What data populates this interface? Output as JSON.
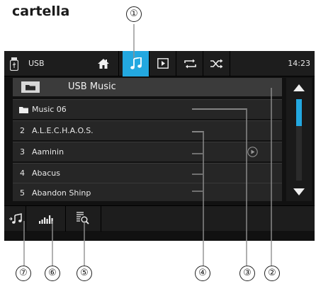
{
  "caption": "cartella",
  "topbar": {
    "source_label": "USB",
    "time": "14:23",
    "active_tab_color": "#23a8e0",
    "icons": [
      "usb-icon",
      "home-icon",
      "music-note-icon",
      "video-play-icon",
      "repeat-icon",
      "shuffle-icon"
    ]
  },
  "list": {
    "header": "USB Music",
    "folder": "Music 06",
    "tracks": [
      {
        "num": "2",
        "title": "A.L.E.C.H.A.O.S."
      },
      {
        "num": "3",
        "title": "Aaminin"
      },
      {
        "num": "4",
        "title": "Abacus"
      },
      {
        "num": "5",
        "title": "Abandon Shinp"
      }
    ]
  },
  "bottombar": {
    "icons": [
      "music-source-icon",
      "equalizer-icon",
      "search-list-icon"
    ]
  },
  "callouts": [
    "①",
    "②",
    "③",
    "④",
    "⑤",
    "⑥",
    "⑦"
  ]
}
